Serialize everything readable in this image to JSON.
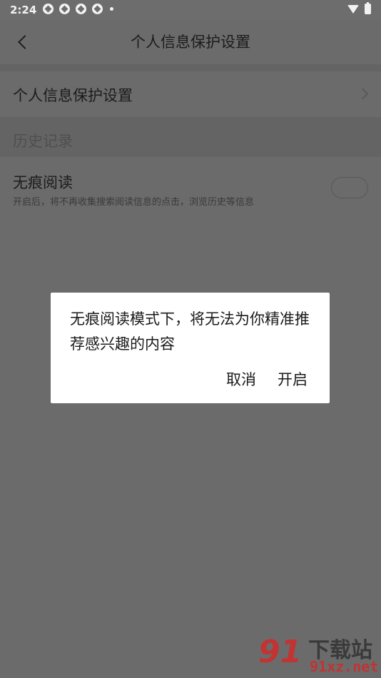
{
  "status": {
    "time": "2:24"
  },
  "header": {
    "title": "个人信息保护设置"
  },
  "settings": {
    "privacy_row": "个人信息保护设置",
    "history_section": "历史记录",
    "incognito": {
      "title": "无痕阅读",
      "desc": "开启后，将不再收集搜索阅读信息的点击，浏览历史等信息"
    }
  },
  "dialog": {
    "message": "无痕阅读模式下，将无法为你精准推荐感兴趣的内容",
    "cancel": "取消",
    "confirm": "开启"
  },
  "watermark": {
    "logo": "91",
    "main": "下载站",
    "sub": "91xz.net"
  }
}
